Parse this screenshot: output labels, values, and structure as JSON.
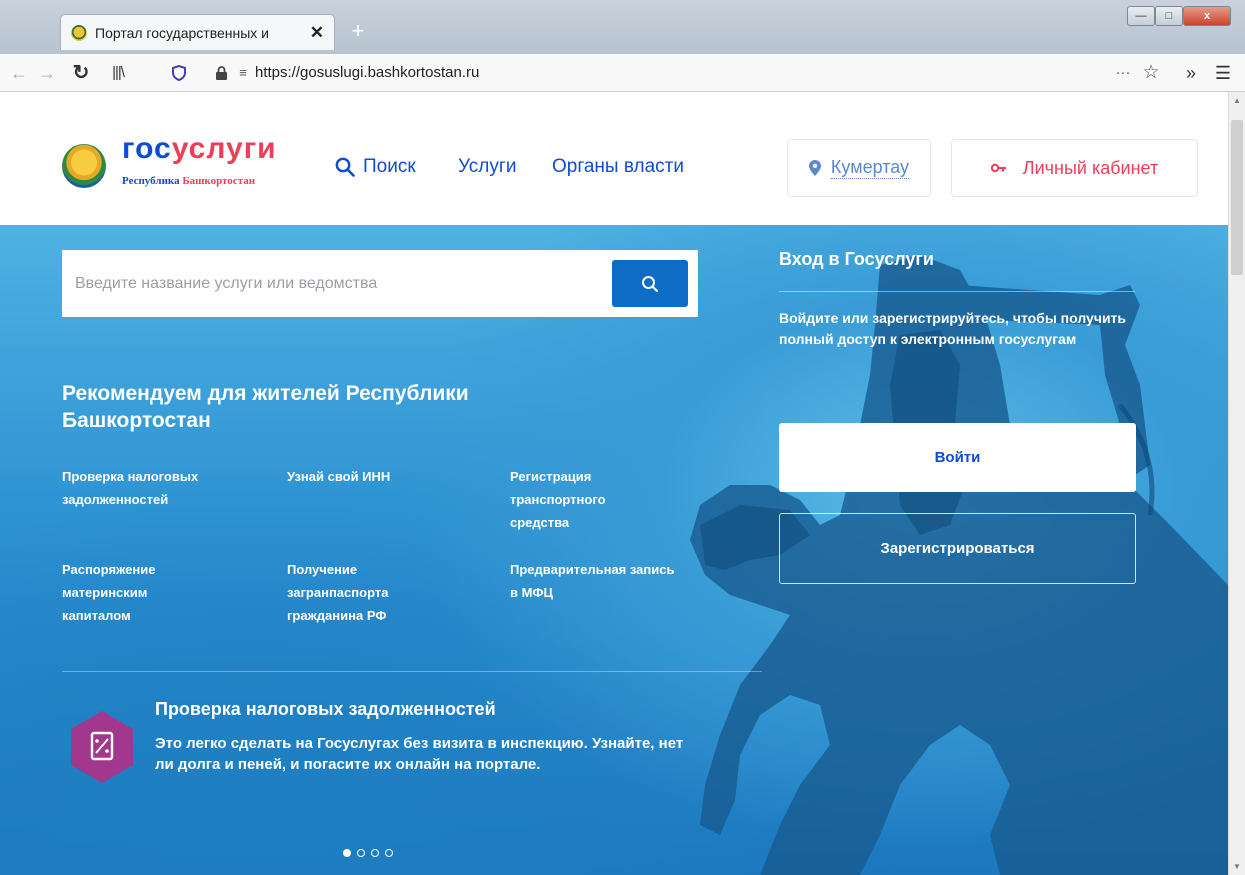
{
  "browser": {
    "tab_title": "Портал государственных и",
    "tab_close": "✕",
    "new_tab": "+",
    "url": "https://gosuslugi.bashkortostan.ru",
    "overflow": "···",
    "more": "»"
  },
  "header": {
    "logo_part1": "гос",
    "logo_part2": "услуги",
    "logo_sub1": "Республика ",
    "logo_sub2": "Башкортостан",
    "nav_search": "Поиск",
    "nav_services": "Услуги",
    "nav_authorities": "Органы власти",
    "city": "Кумертау",
    "cabinet": "Личный кабинет"
  },
  "search": {
    "placeholder": "Введите название услуги или ведомства"
  },
  "recommend": {
    "title": "Рекомендуем для жителей Республики Башкортостан",
    "items": [
      "Проверка налоговых задолженностей",
      "Узнай свой ИНН",
      "Регистрация транспортного средства",
      "Распоряжение материнским капиталом",
      "Получение загранпаспорта гражданина РФ",
      "Предварительная запись в МФЦ"
    ]
  },
  "promo": {
    "title": "Проверка налоговых задолженностей",
    "text": "Это легко сделать на Госуслугах без визита в инспекцию. Узнайте, нет ли долга и пеней, и погасите их онлайн на портале."
  },
  "login": {
    "title": "Вход в Госуслуги",
    "text": "Войдите или зарегистрируйтесь, чтобы получить полный доступ к электронным госуслугам",
    "login_button": "Войти",
    "register_button": "Зарегистрироваться"
  },
  "carousel": {
    "total": 4,
    "active": 1
  },
  "colors": {
    "brand_blue": "#0d4cd3",
    "brand_red": "#ee3f58",
    "promo_purple": "#a2388e"
  }
}
